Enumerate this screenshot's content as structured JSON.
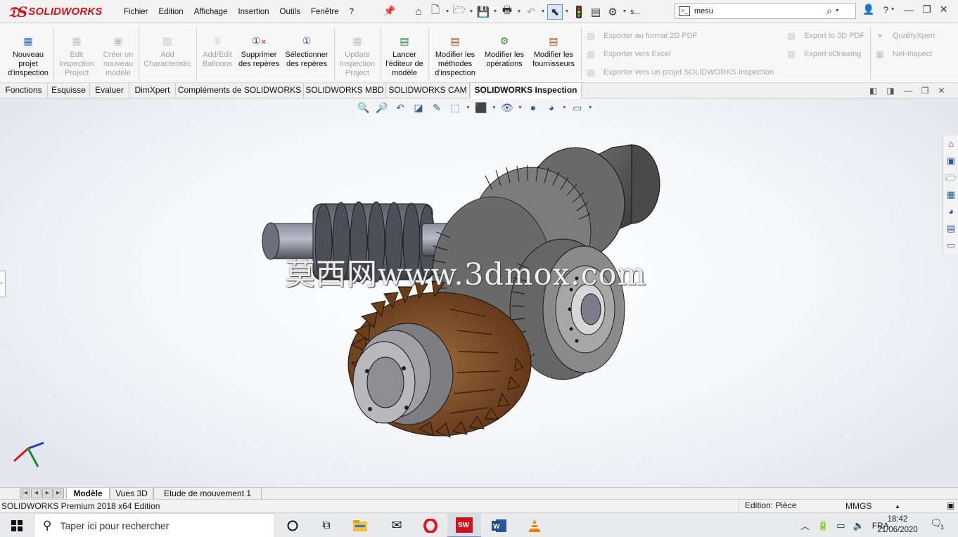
{
  "app": {
    "brand": "SOLIDWORKS",
    "menus": [
      "Fichier",
      "Edition",
      "Affichage",
      "Insertion",
      "Outils",
      "Fenêtre",
      "?"
    ],
    "quick_text": "s...",
    "search_value": "mesu",
    "search_placeholder": ""
  },
  "command_manager": {
    "buttons": [
      {
        "label": "Nouveau projet d'inspection",
        "icon": "new-inspection-project-icon",
        "enabled": true
      },
      {
        "label": "Edit Inspection Project",
        "icon": "edit-inspection-project-icon",
        "enabled": false
      },
      {
        "label": "Créer un nouveau modèle",
        "icon": "new-template-icon",
        "enabled": false
      },
      {
        "label": "Add Characteristic",
        "icon": "add-characteristic-icon",
        "enabled": false
      },
      {
        "label": "Add/Edit Balloons",
        "icon": "balloons-icon",
        "enabled": false
      },
      {
        "label": "Supprimer des repères",
        "icon": "delete-balloons-icon",
        "enabled": true
      },
      {
        "label": "Sélectionner des repères",
        "icon": "select-balloons-icon",
        "enabled": true
      },
      {
        "label": "Update Inspection Project",
        "icon": "update-inspection-project-icon",
        "enabled": false
      },
      {
        "label": "Lancer l'éditeur de modèle",
        "icon": "template-editor-icon",
        "enabled": true
      },
      {
        "label": "Modifier les méthodes d'inspection",
        "icon": "inspection-methods-icon",
        "enabled": true
      },
      {
        "label": "Modifier les opérations",
        "icon": "operations-icon",
        "enabled": true
      },
      {
        "label": "Modifier les fournisseurs",
        "icon": "vendors-icon",
        "enabled": true
      }
    ],
    "export_left": [
      "Exporter au format 2D PDF",
      "Exporter vers Excel",
      "Exporter vers un projet SOLIDWORKS Inspection"
    ],
    "export_right": [
      "Export to 3D PDF",
      "Export eDrawing"
    ],
    "extra": [
      "QualityXpert",
      "Net-Inspect"
    ]
  },
  "tabs": [
    "Fonctions",
    "Esquisse",
    "Evaluer",
    "DimXpert",
    "Compléments de SOLIDWORKS",
    "SOLIDWORKS MBD",
    "SOLIDWORKS CAM",
    "SOLIDWORKS Inspection"
  ],
  "active_tab": "SOLIDWORKS Inspection",
  "viewport": {
    "watermark": "莫西网www.3dmox.com",
    "model_colors": {
      "shaft": "#5a5d66",
      "bronze_gear": "#7a4a26",
      "steel_gear": "#6e6e6e"
    }
  },
  "bottom_tabs": [
    "Modèle",
    "Vues 3D",
    "Etude de mouvement 1"
  ],
  "active_bottom_tab": "Modèle",
  "status": {
    "left": "SOLIDWORKS Premium 2018 x64 Edition",
    "edition": "Edition: Pièce",
    "units": "MMGS",
    "units_caret": "▲"
  },
  "taskbar": {
    "search_text": "Taper ici pour rechercher",
    "language": "FRA",
    "time": "18:42",
    "date": "21/06/2020",
    "notif_count": "1"
  }
}
